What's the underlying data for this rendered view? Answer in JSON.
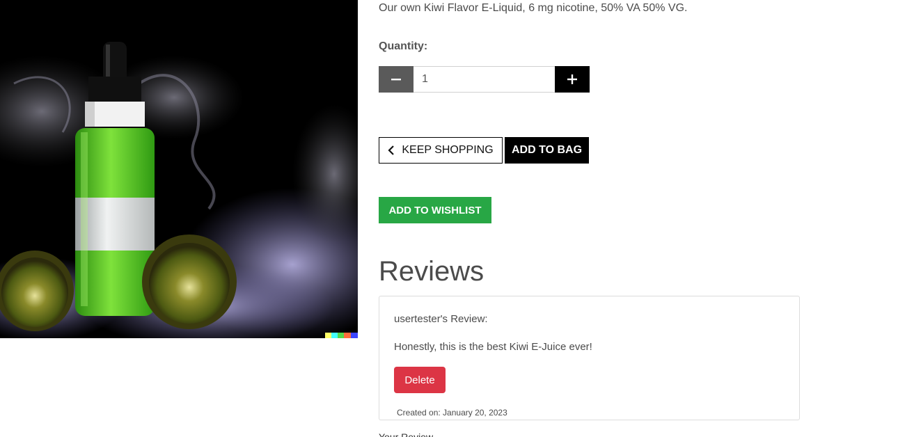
{
  "product": {
    "image_alt": "Kiwi flavor e-liquid bottle with kiwi halves and smoke",
    "description": "Our own Kiwi Flavor E-Liquid, 6 mg nicotine, 50% VA 50% VG."
  },
  "quantity": {
    "label": "Quantity:",
    "value": "1",
    "minus_icon": "minus-icon",
    "plus_icon": "plus-icon"
  },
  "actions": {
    "keep_shopping": "KEEP SHOPPING",
    "add_to_bag": "ADD TO BAG",
    "add_to_wishlist": "ADD TO WISHLIST"
  },
  "reviews": {
    "heading": "Reviews",
    "items": [
      {
        "author": "usertester's Review:",
        "text": "Honestly, this is the best Kiwi E-Juice ever!",
        "delete_label": "Delete",
        "created": "Created on: January 20, 2023"
      }
    ],
    "next_cut_text": "Your Review"
  },
  "colors": {
    "wishlist_green": "#28a745",
    "delete_red": "#dc3545",
    "bag_black": "#000000"
  }
}
